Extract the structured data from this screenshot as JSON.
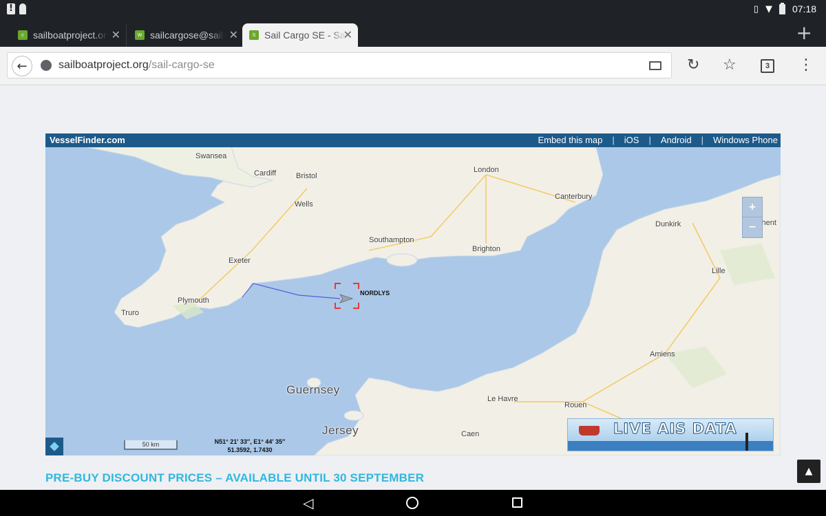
{
  "status_bar": {
    "time": "07:18"
  },
  "tabs": [
    {
      "favicon_letter": "c",
      "title": "sailboatproject.org",
      "close": "✕"
    },
    {
      "favicon_letter": "W",
      "title": "sailcargose@sailboatproject",
      "close": "✕"
    },
    {
      "favicon_letter": "S",
      "title": "Sail Cargo SE - Sailboat",
      "close": "✕"
    }
  ],
  "new_tab": "+",
  "toolbar": {
    "url_host": "sailboatproject.org",
    "url_path": "/sail-cargo-se",
    "tab_count": "3"
  },
  "map": {
    "brand": "VesselFinder.com",
    "links": [
      "Embed this map",
      "iOS",
      "Android",
      "Windows Phone"
    ],
    "separator": "|",
    "places": {
      "swansea": "Swansea",
      "cardiff": "Cardiff",
      "bristol": "Bristol",
      "london": "London",
      "wells": "Wells",
      "canterbury": "Canterbury",
      "dunkirk": "Dunkirk",
      "ghent": "Ghent",
      "southampton": "Southampton",
      "brighton": "Brighton",
      "exeter": "Exeter",
      "lille": "Lille",
      "plymouth": "Plymouth",
      "truro": "Truro",
      "amiens": "Amiens",
      "guernsey": "Guernsey",
      "le_havre": "Le Havre",
      "rouen": "Rouen",
      "jersey": "Jersey",
      "caen": "Caen"
    },
    "vessel_name": "NORDLYS",
    "zoom_in": "+",
    "zoom_out": "−",
    "scale": "50 km",
    "coords_dms": "N51° 21′ 33″, E1° 44′ 35″",
    "coords_decimal": "51.3592, 1.7430",
    "ais_banner": "LIVE AIS DATA"
  },
  "page": {
    "promo_heading": "PRE-BUY DISCOUNT PRICES – AVAILABLE UNTIL 30 SEPTEMBER"
  },
  "colors": {
    "sea": "#abc8e8",
    "land": "#f2efe6",
    "header": "#1d5a8a",
    "promo": "#2fb8e0",
    "vessel_marker": "#e53935",
    "track": "#5a5ad8"
  }
}
